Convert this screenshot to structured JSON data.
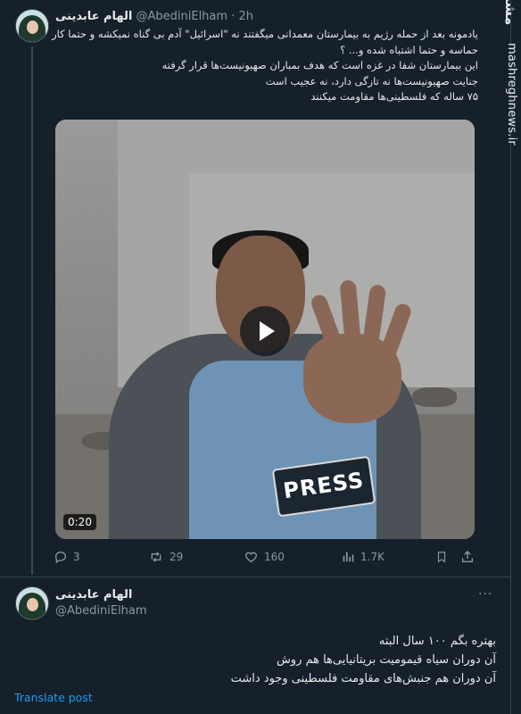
{
  "tweet": {
    "author_name": "الهام عابدینی",
    "handle": "@AbediniElham",
    "time": "· 2h",
    "text_lines": [
      "یادمونه بعد از حمله رژیم به بیمارستان معمدانی میگفتند نه \"اسرائیل\" آدم بی گناه نمیکشه و حتما کار",
      "حماسه و حتما اشتباه شده و... ؟",
      "این بیمارستان شفا در غزه است که هدف بمباران صهیونیست‌ها قرار گرفته",
      "جنایت صهیونیست‌ها نه تازگی دارد، نه عجیب است",
      "۷۵ ساله که فلسطینی‌ها مقاومت میکنند"
    ],
    "video": {
      "duration": "0:20",
      "patch_text": "PRESS"
    },
    "stats": {
      "replies": "3",
      "retweets": "29",
      "likes": "160",
      "views": "1.7K"
    }
  },
  "reply": {
    "author_name": "الهام عابدینی",
    "handle": "@AbediniElham",
    "text_lines": [
      "بهتره بگم ۱۰۰ سال البته",
      "آن دوران سیاه قیمومیت بریتانیایی‌ها هم روش",
      "آن دوران هم جنبش‌های مقاومت فلسطینی وجود داشت"
    ],
    "translate_label": "Translate post"
  },
  "watermark": {
    "logo_text": "مشرق",
    "site": "mashreghnews.ir"
  },
  "colors": {
    "background": "#15202b",
    "text": "#e7e9ea",
    "muted": "#8b98a5",
    "link": "#1d9bf0"
  }
}
